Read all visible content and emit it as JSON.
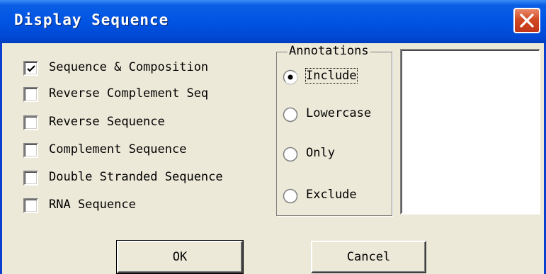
{
  "window": {
    "title": "Display Sequence"
  },
  "icons": {
    "close": "close-icon",
    "check": "checkmark-icon"
  },
  "colors": {
    "titlebar": "#0054e3",
    "close_button": "#d24a23",
    "dialog_bg": "#ece9d8"
  },
  "options": [
    {
      "label": "Sequence & Composition",
      "checked": true
    },
    {
      "label": "Reverse Complement Seq",
      "checked": false
    },
    {
      "label": "Reverse Sequence",
      "checked": false
    },
    {
      "label": "Complement Sequence",
      "checked": false
    },
    {
      "label": "Double Stranded Sequence",
      "checked": false
    },
    {
      "label": "RNA Sequence",
      "checked": false
    }
  ],
  "annotations": {
    "group_label": "Annotations",
    "selected": "Include",
    "choices": [
      {
        "label": "Include",
        "selected": true
      },
      {
        "label": "Lowercase",
        "selected": false
      },
      {
        "label": "Only",
        "selected": false
      },
      {
        "label": "Exclude",
        "selected": false
      }
    ],
    "list_items": []
  },
  "buttons": {
    "ok": "OK",
    "cancel": "Cancel"
  }
}
